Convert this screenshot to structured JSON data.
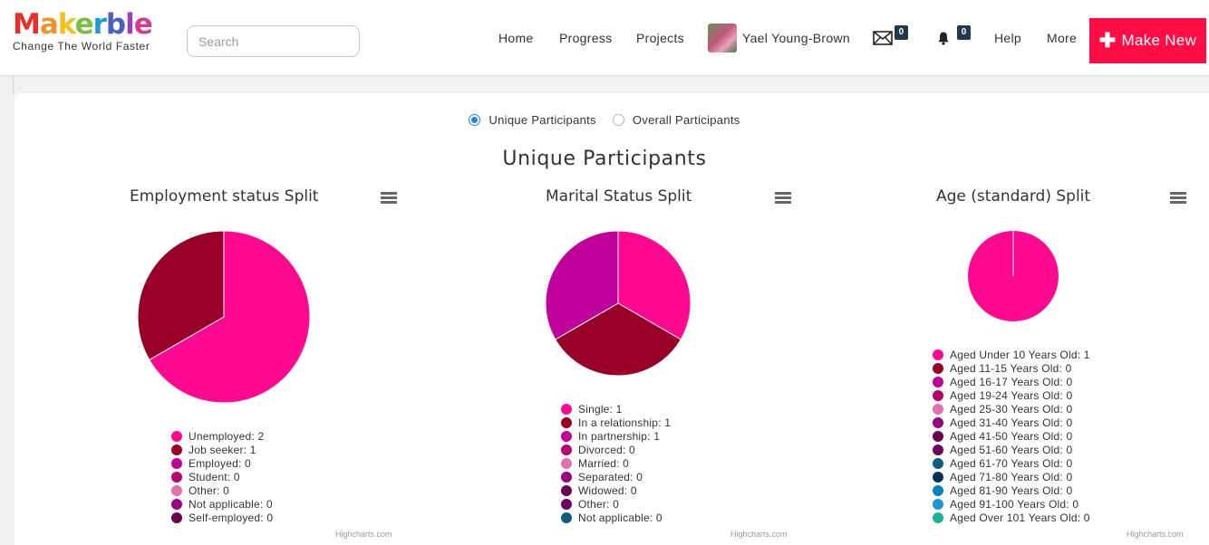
{
  "header": {
    "logo_letters": [
      {
        "ch": "M",
        "color": "#e5302c"
      },
      {
        "ch": "a",
        "color": "#f0932a"
      },
      {
        "ch": "k",
        "color": "#f3c21f"
      },
      {
        "ch": "e",
        "color": "#7cbf3c"
      },
      {
        "ch": "r",
        "color": "#1f9bd7"
      },
      {
        "ch": "b",
        "color": "#4a5fc6"
      },
      {
        "ch": "l",
        "color": "#9b3fb6"
      },
      {
        "ch": "e",
        "color": "#d63a8f"
      }
    ],
    "tagline": "Change The World Faster",
    "search_placeholder": "Search",
    "nav": {
      "home": "Home",
      "progress": "Progress",
      "projects": "Projects",
      "user": "Yael Young-Brown",
      "messages_count": "0",
      "notifications_count": "0",
      "help": "Help",
      "more": "More"
    },
    "make_new": "Make New"
  },
  "filter": {
    "unique": "Unique Participants",
    "overall": "Overall Participants",
    "selected": "unique"
  },
  "main_title": "Unique Participants",
  "credits": "Highcharts.com",
  "chart_data": [
    {
      "type": "pie",
      "title": "Employment status Split",
      "legend_placement": "bottom",
      "slices": [
        {
          "label": "Unemployed",
          "value": 2,
          "color": "#ff0990"
        },
        {
          "label": "Job seeker",
          "value": 1,
          "color": "#990028"
        },
        {
          "label": "Employed",
          "value": 0,
          "color": "#c0009a"
        },
        {
          "label": "Student",
          "value": 0,
          "color": "#b8006e"
        },
        {
          "label": "Other",
          "value": 0,
          "color": "#e470b0"
        },
        {
          "label": "Not applicable",
          "value": 0,
          "color": "#990083"
        },
        {
          "label": "Self-employed",
          "value": 0,
          "color": "#6a0050"
        }
      ]
    },
    {
      "type": "pie",
      "title": "Marital Status Split",
      "legend_placement": "bottom",
      "slices": [
        {
          "label": "Single",
          "value": 1,
          "color": "#ff0990"
        },
        {
          "label": "In a relationship",
          "value": 1,
          "color": "#990028"
        },
        {
          "label": "In partnership",
          "value": 1,
          "color": "#c0009a"
        },
        {
          "label": "Divorced",
          "value": 0,
          "color": "#b8006e"
        },
        {
          "label": "Married",
          "value": 0,
          "color": "#e470b0"
        },
        {
          "label": "Separated",
          "value": 0,
          "color": "#990083"
        },
        {
          "label": "Widowed",
          "value": 0,
          "color": "#6a0050"
        },
        {
          "label": "Other",
          "value": 0,
          "color": "#6a0060"
        },
        {
          "label": "Not applicable",
          "value": 0,
          "color": "#0e5f7f"
        }
      ]
    },
    {
      "type": "pie",
      "title": "Age (standard) Split",
      "legend_placement": "bottom",
      "slices": [
        {
          "label": "Aged Under 10 Years Old",
          "value": 1,
          "color": "#ff0990"
        },
        {
          "label": "Aged 11-15 Years Old",
          "value": 0,
          "color": "#990028"
        },
        {
          "label": "Aged 16-17 Years Old",
          "value": 0,
          "color": "#c0009a"
        },
        {
          "label": "Aged 19-24 Years Old",
          "value": 0,
          "color": "#b8006e"
        },
        {
          "label": "Aged 25-30 Years Old",
          "value": 0,
          "color": "#e470b0"
        },
        {
          "label": "Aged 31-40 Years Old",
          "value": 0,
          "color": "#990083"
        },
        {
          "label": "Aged 41-50 Years Old",
          "value": 0,
          "color": "#6a0050"
        },
        {
          "label": "Aged 51-60 Years Old",
          "value": 0,
          "color": "#6a0060"
        },
        {
          "label": "Aged 61-70 Years Old",
          "value": 0,
          "color": "#0e5f7f"
        },
        {
          "label": "Aged 71-80 Years Old",
          "value": 0,
          "color": "#0b2f5c"
        },
        {
          "label": "Aged 81-90 Years Old",
          "value": 0,
          "color": "#0a82b9"
        },
        {
          "label": "Aged 91-100 Years Old",
          "value": 0,
          "color": "#1e94d6"
        },
        {
          "label": "Aged Over 101 Years Old",
          "value": 0,
          "color": "#1fae96"
        }
      ]
    }
  ]
}
